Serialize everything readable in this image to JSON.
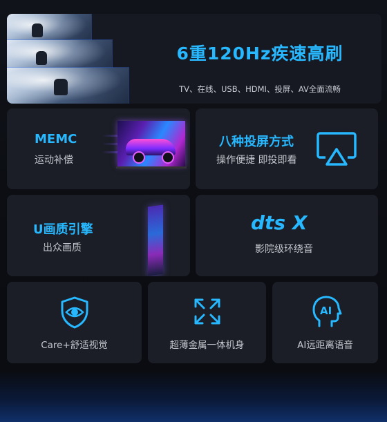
{
  "hero": {
    "title": "6重120Hz疾速高刷",
    "subtitle": "TV、在线、USB、HDMI、投屏、AV全面流畅"
  },
  "features": {
    "memc": {
      "title": "MEMC",
      "subtitle": "运动补偿"
    },
    "cast": {
      "title": "八种投屏方式",
      "subtitle": "操作便捷 即投即看"
    },
    "uquality": {
      "title": "U画质引擎",
      "subtitle": "出众画质"
    },
    "audio": {
      "logo_text": "dts X",
      "subtitle": "影院级环绕音"
    }
  },
  "bottom_features": [
    {
      "icon": "eye-shield-icon",
      "label": "Care+舒适视觉"
    },
    {
      "icon": "expand-icon",
      "label": "超薄金属一体机身"
    },
    {
      "icon": "ai-voice-head-icon",
      "label": "AI远距离语音"
    }
  ],
  "colors": {
    "accent": "#27b8ff",
    "card_bg": "#1b1e26",
    "page_bg": "#0b0d12",
    "text_muted": "#c4c7ce"
  }
}
